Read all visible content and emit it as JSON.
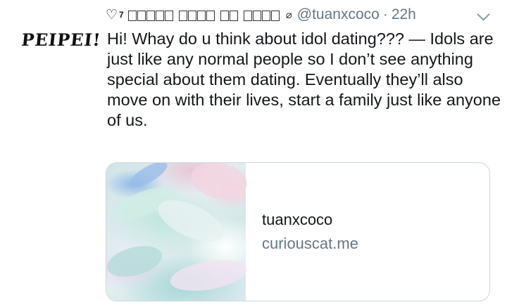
{
  "avatar": {
    "text": "PEIPEI!"
  },
  "tweet": {
    "display_name_prefix": "♡",
    "display_name_superscript": "7",
    "handle": "@tuanxcoco",
    "separator": "·",
    "time": "22h",
    "text": "Hi! Whay do u think about idol dating??? — Idols are just like any normal people so I don’t see anything special about them dating. Eventually they’ll also move on with their lives, start a family just like anyone of us."
  },
  "card": {
    "title": "tuanxcoco",
    "domain": "curiouscat.me"
  },
  "colors": {
    "text": "#14171a",
    "secondary": "#657786",
    "card_border": "#ccd6dd"
  },
  "icons": [
    "heart-icon",
    "tag-icon",
    "chevron-down-icon"
  ]
}
